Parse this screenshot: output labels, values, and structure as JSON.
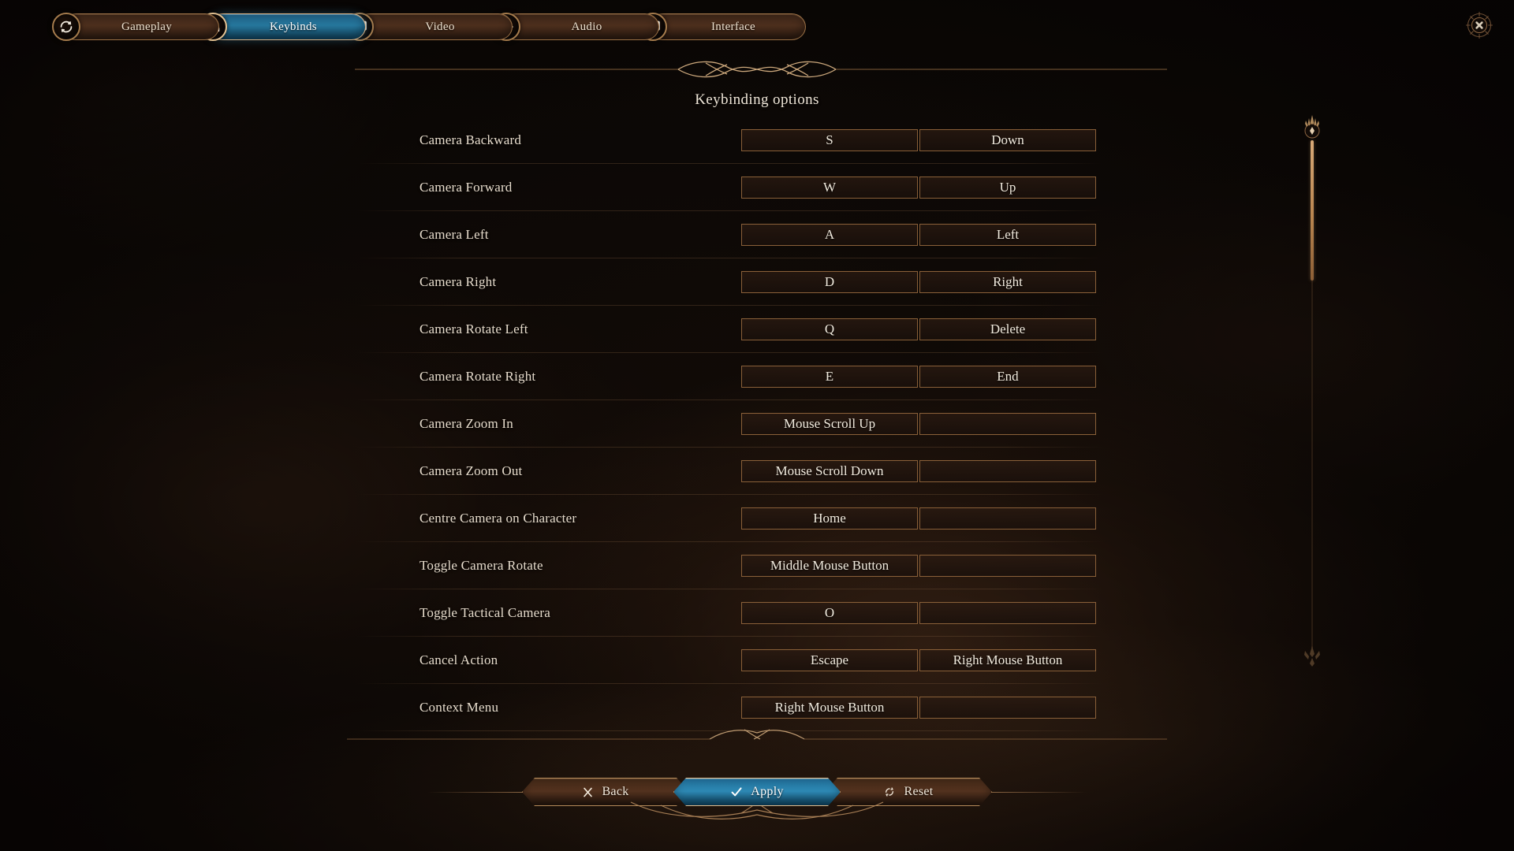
{
  "window": {
    "close_icon": "close-x-icon"
  },
  "tabs": [
    {
      "id": "gameplay",
      "label": "Gameplay",
      "icon": "gameplay-cycle-icon",
      "active": false
    },
    {
      "id": "keybinds",
      "label": "Keybinds",
      "icon": "keybinds-keys-icon",
      "active": true
    },
    {
      "id": "video",
      "label": "Video",
      "icon": "video-monitor-icon",
      "active": false
    },
    {
      "id": "audio",
      "label": "Audio",
      "icon": "audio-waves-icon",
      "active": false
    },
    {
      "id": "interface",
      "label": "Interface",
      "icon": "interface-screen-icon",
      "active": false
    }
  ],
  "panel": {
    "title": "Keybinding options"
  },
  "keybinds": [
    {
      "action": "Camera Backward",
      "primary": "S",
      "secondary": "Down"
    },
    {
      "action": "Camera Forward",
      "primary": "W",
      "secondary": "Up"
    },
    {
      "action": "Camera Left",
      "primary": "A",
      "secondary": "Left"
    },
    {
      "action": "Camera Right",
      "primary": "D",
      "secondary": "Right"
    },
    {
      "action": "Camera Rotate Left",
      "primary": "Q",
      "secondary": "Delete"
    },
    {
      "action": "Camera Rotate Right",
      "primary": "E",
      "secondary": "End"
    },
    {
      "action": "Camera Zoom In",
      "primary": "Mouse Scroll Up",
      "secondary": ""
    },
    {
      "action": "Camera Zoom Out",
      "primary": "Mouse Scroll Down",
      "secondary": ""
    },
    {
      "action": "Centre Camera on Character",
      "primary": "Home",
      "secondary": ""
    },
    {
      "action": "Toggle Camera Rotate",
      "primary": "Middle Mouse Button",
      "secondary": ""
    },
    {
      "action": "Toggle Tactical Camera",
      "primary": "O",
      "secondary": ""
    },
    {
      "action": "Cancel Action",
      "primary": "Escape",
      "secondary": "Right Mouse Button"
    },
    {
      "action": "Context Menu",
      "primary": "Right Mouse Button",
      "secondary": ""
    }
  ],
  "scrollbar": {
    "orientation": "vertical",
    "thumb_position_percent": 0
  },
  "footer": {
    "back": {
      "label": "Back",
      "icon": "x-mark-icon"
    },
    "apply": {
      "label": "Apply",
      "icon": "check-mark-icon"
    },
    "reset": {
      "label": "Reset",
      "icon": "refresh-circle-icon"
    }
  },
  "colors": {
    "accent_blue": "#2f8cb8",
    "frame_gold": "#b58a59",
    "panel_brown": "#55331f",
    "text_cream": "#f2e9db",
    "background_dark": "#140d08"
  }
}
